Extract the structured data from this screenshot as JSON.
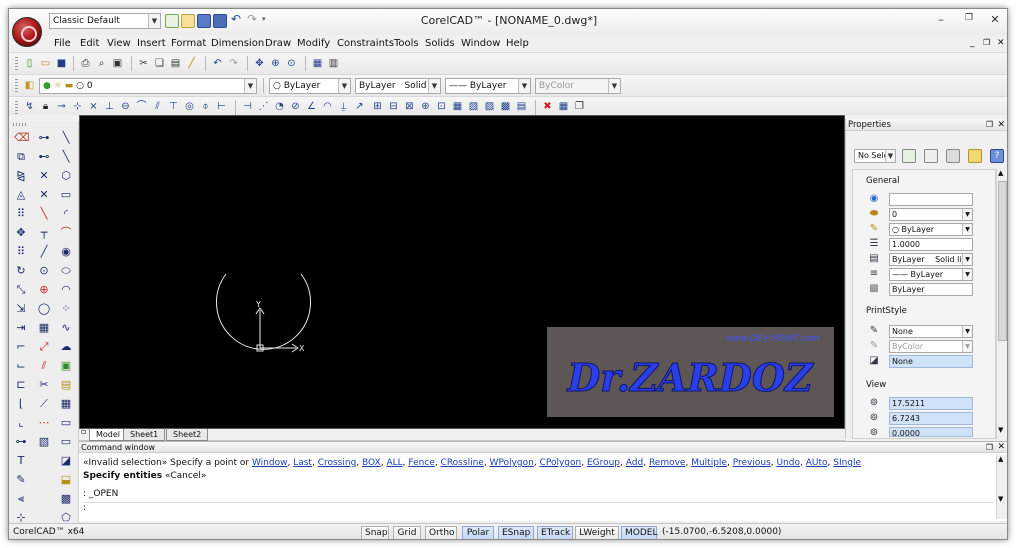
{
  "titlebar": {
    "workspace": "Classic Default",
    "title": "CorelCAD™ - [NONAME_0.dwg*]"
  },
  "menu": [
    "File",
    "Edit",
    "View",
    "Insert",
    "Format",
    "Dimension",
    "Draw",
    "Modify",
    "Constraints",
    "Tools",
    "Solids",
    "Window",
    "Help"
  ],
  "layer_bar": {
    "layer": "0",
    "color": "ByLayer",
    "linetype": "ByLayer",
    "linestyle": "Solid line",
    "lineweight": "ByLayer",
    "plotstyle": "ByColor"
  },
  "canvas": {
    "ucs_y": "Y",
    "ucs_x": "X",
    "watermark_url": "www.DEV-POINT.com",
    "watermark_name": "Dr.ZARDOZ"
  },
  "tabs": [
    "Model",
    "Sheet1",
    "Sheet2"
  ],
  "properties": {
    "title": "Properties",
    "selector": "No Sele",
    "general_label": "General",
    "fields": {
      "color": "",
      "layer": "0",
      "color_val": "ByLayer",
      "linescale": "1.0000",
      "linetype": "ByLayer",
      "linetype_style": "Solid line",
      "lineweight": "ByLayer",
      "transparency": "ByLayer"
    },
    "printstyle_label": "PrintStyle",
    "print": {
      "style": "None",
      "color": "ByColor",
      "table": "None"
    },
    "view_label": "View",
    "view": {
      "center_x": "17.5211",
      "center_y": "6.7243",
      "center_z": "0.0000"
    }
  },
  "command": {
    "title": "Command window",
    "line1_prefix": "«Invalid selection» Specify a point or",
    "options": [
      "Window",
      "Last",
      "Crossing",
      "BOX",
      "ALL",
      "Fence",
      "CRossline",
      "WPolygon",
      "CPolygon",
      "EGroup",
      "Add",
      "Remove",
      "Multiple",
      "Previous",
      "Undo",
      "AUto",
      "SIngle"
    ],
    "line2": "Specify entities",
    "line2_cancel": "«Cancel»",
    "line3": ": _OPEN",
    "prompt": ":"
  },
  "status": {
    "app": "CorelCAD™ x64",
    "buttons": [
      "Snap",
      "Grid",
      "Ortho",
      "Polar",
      "ESnap",
      "ETrack",
      "LWeight",
      "MODEL"
    ],
    "coords": "(-15.0700,-6.5208,0.0000)"
  },
  "colors": {
    "canvas_bg": "#000000",
    "accent": "#1a3fb5",
    "watermark_blue": "#2b3fe8",
    "watermark_bg": "#5e5655",
    "active_toggle": "#c4d8f3"
  }
}
